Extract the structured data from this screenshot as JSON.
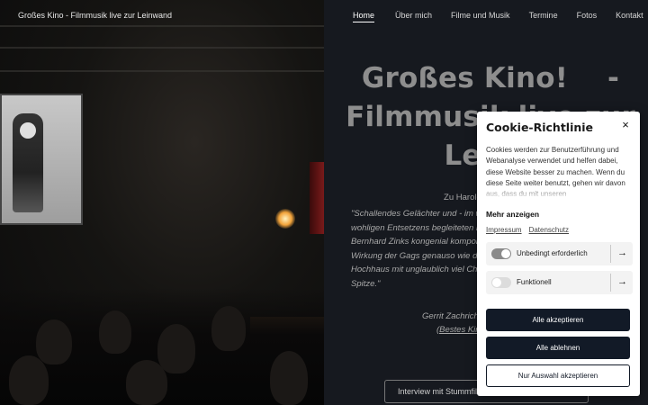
{
  "header": {
    "site_title": "Großes Kino - Filmmusik live zur Leinwand",
    "nav": [
      {
        "label": "Home",
        "active": true
      },
      {
        "label": "Über mich",
        "active": false
      },
      {
        "label": "Filme und Musik",
        "active": false
      },
      {
        "label": "Termine",
        "active": false
      },
      {
        "label": "Fotos",
        "active": false
      },
      {
        "label": "Kontakt",
        "active": false
      }
    ]
  },
  "hero": {
    "title_line1": "Großes Kino!    -",
    "title_line2": "Filmmusik live zur",
    "title_line3": "Leinw"
  },
  "quote": {
    "intro": "Zu Harold Lloyd's \"Saf",
    "lines": [
      "\"Schallendes Gelächter und - im we",
      "wohligen Entsetzens begleiteten H",
      "Bernhard Zinks kongenial kompon",
      "Wirkung der Gags genauso wie der",
      "Hochhaus mit unglaublich viel Char",
      "Spitze.\""
    ],
    "author": "Gerrit Zachrich,",
    "author_link": "(Bestes Kin"
  },
  "interview_button": "Interview mit Stummfilm",
  "cookie": {
    "title": "Cookie-Richtlinie",
    "close_symbol": "×",
    "description": "Cookies werden zur Benutzerführung und Webanalyse verwendet und helfen dabei, diese Website besser zu machen. Wenn du diese Seite weiter benutzt, gehen wir davon aus, dass du mit unseren",
    "more_label": "Mehr anzeigen",
    "links": [
      "Impressum",
      "Datenschutz"
    ],
    "options": [
      {
        "label": "Unbedingt erforderlich",
        "enabled": true
      },
      {
        "label": "Funktionell",
        "enabled": false
      }
    ],
    "arrow_symbol": "→",
    "accept_all": "Alle akzeptieren",
    "reject_all": "Alle ablehnen",
    "accept_selection": "Nur Auswahl akzeptieren"
  },
  "colors": {
    "page_bg": "#16191f",
    "primary_button": "#121a27",
    "toggle_on": "#8a8a8a",
    "toggle_off": "#dcdcdc"
  }
}
